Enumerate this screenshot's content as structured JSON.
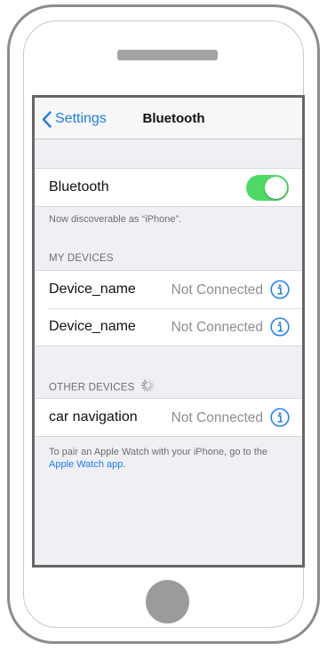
{
  "nav": {
    "back_label": "Settings",
    "title": "Bluetooth"
  },
  "bluetooth": {
    "label": "Bluetooth",
    "enabled": true,
    "toggle_color": "#4cd964",
    "discoverable_text": "Now discoverable as “iPhone”."
  },
  "my_devices": {
    "header": "MY DEVICES",
    "items": [
      {
        "name": "Device_name",
        "status": "Not Connected"
      },
      {
        "name": "Device_name",
        "status": "Not Connected"
      }
    ]
  },
  "other_devices": {
    "header": "OTHER DEVICES",
    "items": [
      {
        "name": "car navigation",
        "status": "Not Connected"
      }
    ]
  },
  "footer": {
    "text_before": "To pair an Apple Watch with your iPhone, go to the ",
    "link_text": "Apple Watch app",
    "text_after": "."
  },
  "colors": {
    "accent": "#1e7cf0",
    "secondary_text": "#8e8e93",
    "background": "#efeff4"
  }
}
